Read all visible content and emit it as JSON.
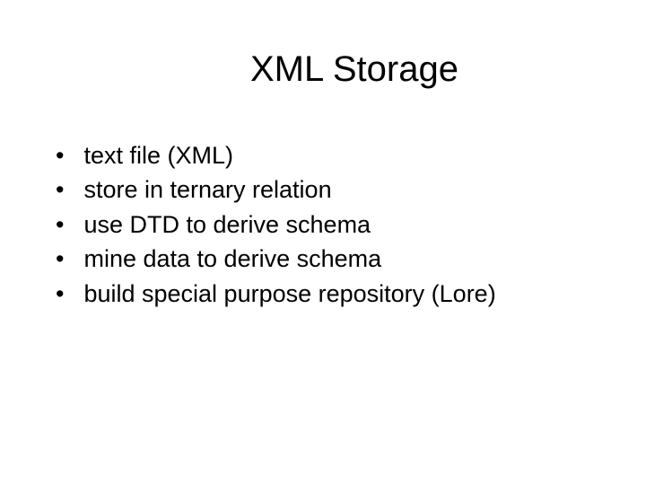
{
  "slide": {
    "title": "XML Storage",
    "bullets": [
      "text file (XML)",
      "store in ternary relation",
      "use DTD to derive schema",
      "mine data to derive schema",
      "build special purpose repository (Lore)"
    ]
  }
}
